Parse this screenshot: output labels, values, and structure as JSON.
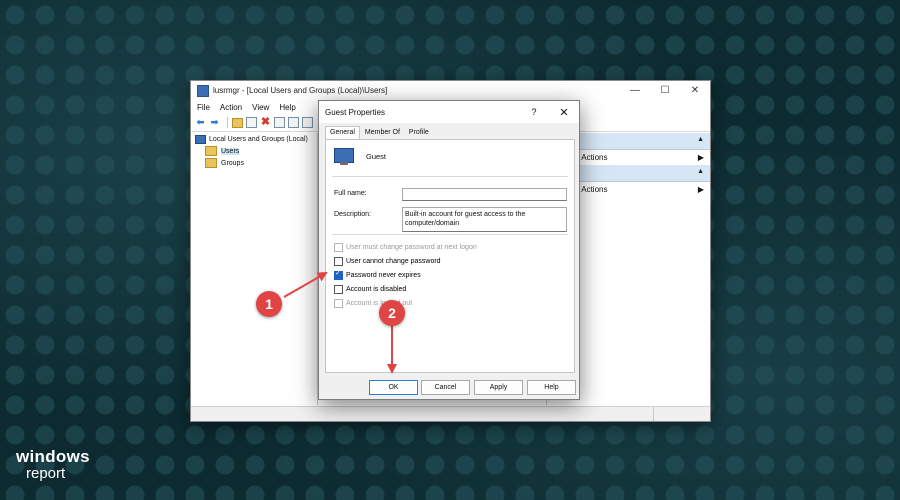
{
  "window": {
    "title": "lusrmgr - [Local Users and Groups (Local)\\Users]",
    "controls": [
      "—",
      "☐",
      "✕"
    ],
    "menu": [
      "File",
      "Action",
      "View",
      "Help"
    ],
    "tree": {
      "root": "Local Users and Groups (Local)",
      "children": [
        "Users",
        "Groups"
      ]
    },
    "actions": {
      "item1": "e Actions",
      "item2": "e Actions"
    }
  },
  "dialog": {
    "title": "Guest Properties",
    "help": "?",
    "close": "✕",
    "tabs": [
      "General",
      "Member Of",
      "Profile"
    ],
    "user_name": "Guest",
    "full_name_label": "Full name:",
    "full_name_value": "",
    "description_label": "Description:",
    "description_value": "Built-in account for guest access to the computer/domain",
    "checkboxes": [
      {
        "label": "User must change password at next logon",
        "checked": false,
        "disabled": true
      },
      {
        "label": "User cannot change password",
        "checked": false,
        "disabled": false
      },
      {
        "label": "Password never expires",
        "checked": true,
        "disabled": false
      },
      {
        "label": "Account is disabled",
        "checked": false,
        "disabled": false
      },
      {
        "label": "Account is locked out",
        "checked": false,
        "disabled": true
      }
    ],
    "buttons": [
      "OK",
      "Cancel",
      "Apply",
      "Help"
    ]
  },
  "annotations": {
    "step1": "1",
    "step2": "2",
    "color": "#e04444"
  },
  "brand": {
    "line1": "windows",
    "line2": "report"
  }
}
